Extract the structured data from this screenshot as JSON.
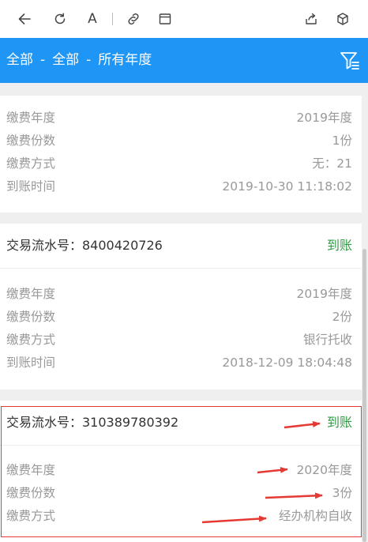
{
  "toolbar": {
    "icons": [
      "back-arrow-icon",
      "refresh-icon",
      "text-size-icon",
      "link-icon",
      "window-icon",
      "share-icon",
      "cube-icon"
    ],
    "text_size_glyph": "A"
  },
  "filter": {
    "part1": "全部",
    "part2": "全部",
    "part3": "所有年度",
    "separator": "-",
    "icon": "filter-icon"
  },
  "records": [
    {
      "year_label": "缴费年度",
      "year_value": "2019年度",
      "count_label": "缴费份数",
      "count_value": "1份",
      "method_label": "缴费方式",
      "method_value": "无：21",
      "time_label": "到账时间",
      "time_value": "2019-10-30 11:18:02"
    },
    {
      "txn_label": "交易流水号：8400420726",
      "status": "到账",
      "year_label": "缴费年度",
      "year_value": "2019年度",
      "count_label": "缴费份数",
      "count_value": "2份",
      "method_label": "缴费方式",
      "method_value": "银行托收",
      "time_label": "到账时间",
      "time_value": "2018-12-09 18:04:48"
    },
    {
      "txn_label": "交易流水号：310389780392",
      "status": "到账",
      "year_label": "缴费年度",
      "year_value": "2020年度",
      "count_label": "缴费份数",
      "count_value": "3份",
      "method_label": "缴费方式",
      "method_value": "经办机构自收"
    }
  ],
  "colors": {
    "header_blue": "#1f95f5",
    "status_green": "#2e9a43",
    "annotation_red": "#e53935",
    "muted_text": "#999999"
  }
}
